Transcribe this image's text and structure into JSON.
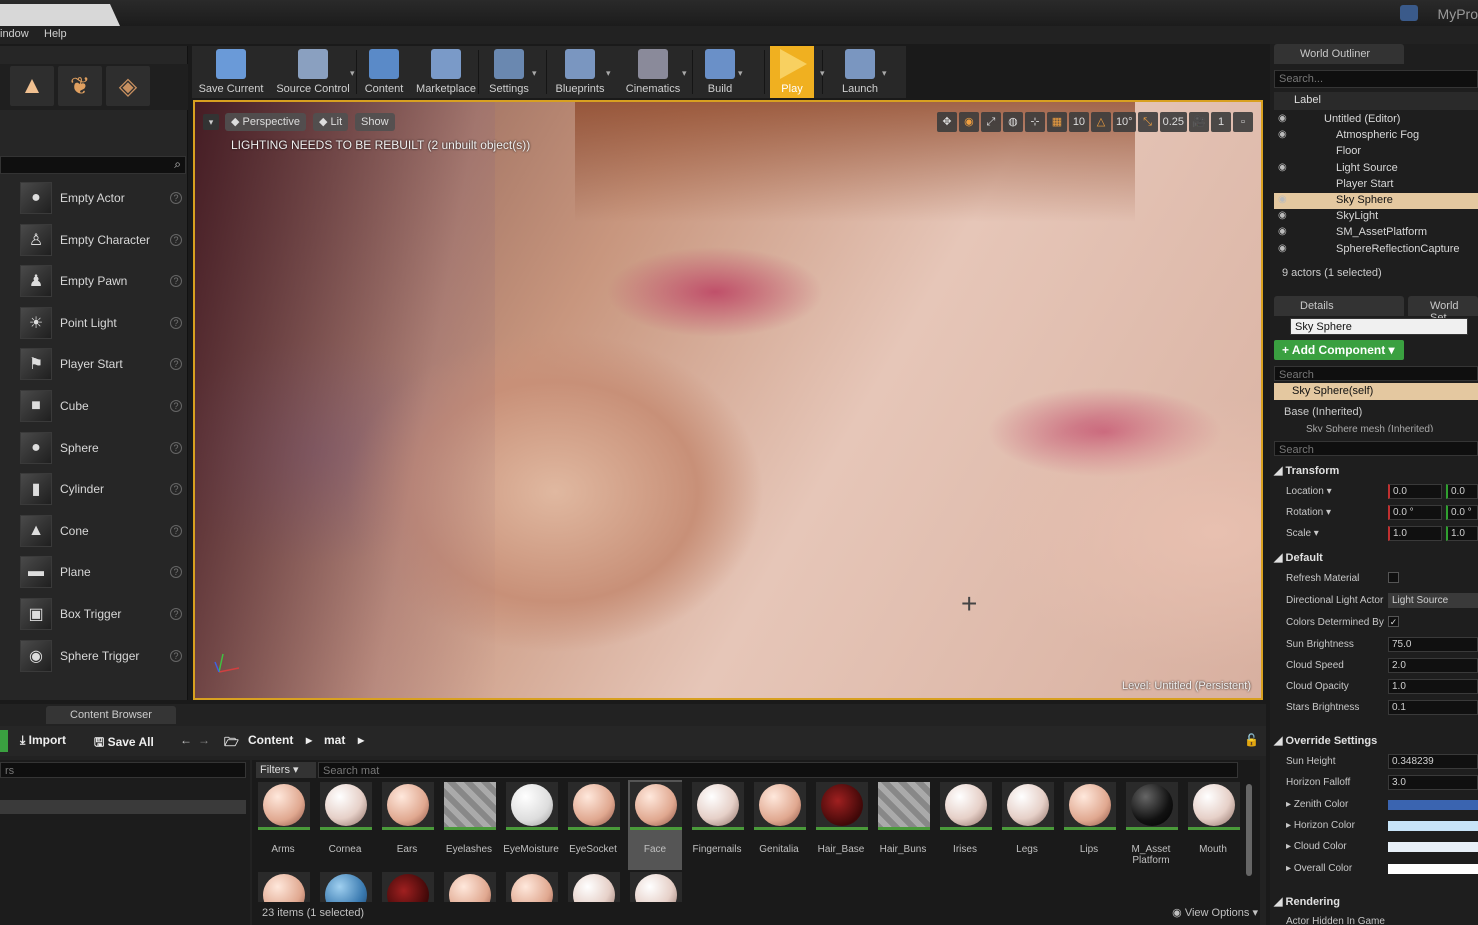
{
  "window": {
    "project_title": "MyPro"
  },
  "menu": [
    "indow",
    "Help"
  ],
  "modes": {
    "tabs": [
      {
        "icon": "place-mode-icon",
        "glyph": "▲"
      },
      {
        "icon": "foliage-mode-icon",
        "glyph": "❦"
      },
      {
        "icon": "geometry-mode-icon",
        "glyph": "◈"
      }
    ],
    "items": [
      {
        "label": "Empty Actor",
        "icon": "sphere-icon",
        "glyph": "●"
      },
      {
        "label": "Empty Character",
        "icon": "character-icon",
        "glyph": "♙"
      },
      {
        "label": "Empty Pawn",
        "icon": "pawn-icon",
        "glyph": "♟"
      },
      {
        "label": "Point Light",
        "icon": "light-bulb-icon",
        "glyph": "☀"
      },
      {
        "label": "Player Start",
        "icon": "player-start-icon",
        "glyph": "⚑"
      },
      {
        "label": "Cube",
        "icon": "cube-icon",
        "glyph": "■"
      },
      {
        "label": "Sphere",
        "icon": "sphere-icon",
        "glyph": "●"
      },
      {
        "label": "Cylinder",
        "icon": "cylinder-icon",
        "glyph": "▮"
      },
      {
        "label": "Cone",
        "icon": "cone-icon",
        "glyph": "▲"
      },
      {
        "label": "Plane",
        "icon": "plane-icon",
        "glyph": "▬"
      },
      {
        "label": "Box Trigger",
        "icon": "box-trigger-icon",
        "glyph": "▣"
      },
      {
        "label": "Sphere Trigger",
        "icon": "sphere-trigger-icon",
        "glyph": "◉"
      }
    ],
    "help_glyph": "?"
  },
  "toolbar": {
    "buttons": [
      {
        "label": "Save Current",
        "icon": "save-icon",
        "color": "#6a9ad8"
      },
      {
        "label": "Source Control",
        "icon": "source-control-icon",
        "color": "#8aa0c0"
      },
      {
        "label": "Content",
        "icon": "content-icon",
        "color": "#5a8ac8"
      },
      {
        "label": "Marketplace",
        "icon": "marketplace-icon",
        "color": "#7a9ac8"
      },
      {
        "label": "Settings",
        "icon": "settings-icon",
        "color": "#6a88b0"
      },
      {
        "label": "Blueprints",
        "icon": "blueprints-icon",
        "color": "#7a96c0"
      },
      {
        "label": "Cinematics",
        "icon": "cinematics-icon",
        "color": "#8a8a9a"
      },
      {
        "label": "Build",
        "icon": "build-icon",
        "color": "#6a90c8"
      },
      {
        "label": "Play",
        "icon": "play-icon",
        "color": "#f0b020"
      },
      {
        "label": "Launch",
        "icon": "launch-icon",
        "color": "#7a96c0"
      }
    ]
  },
  "viewport": {
    "perspective": "Perspective",
    "lit": "Lit",
    "show": "Show",
    "warning": "LIGHTING NEEDS TO BE REBUILT (2 unbuilt object(s))",
    "grid_snap": "10",
    "rot_snap": "10°",
    "scale_snap": "0.25",
    "camera_speed": "1",
    "level": "Level:  Untitled (Persistent)"
  },
  "outliner": {
    "tab": "World Outliner",
    "search_placeholder": "Search...",
    "column": "Label",
    "rows": [
      {
        "name": "Untitled (Editor)",
        "eye": true,
        "indent": 0
      },
      {
        "name": "Atmospheric Fog",
        "eye": true,
        "indent": 1
      },
      {
        "name": "Floor",
        "eye": false,
        "indent": 1
      },
      {
        "name": "Light Source",
        "eye": true,
        "indent": 1
      },
      {
        "name": "Player Start",
        "eye": false,
        "indent": 1
      },
      {
        "name": "Sky Sphere",
        "eye": true,
        "indent": 1,
        "selected": true
      },
      {
        "name": "SkyLight",
        "eye": true,
        "indent": 1
      },
      {
        "name": "SM_AssetPlatform",
        "eye": true,
        "indent": 1
      },
      {
        "name": "SphereReflectionCapture",
        "eye": true,
        "indent": 1
      }
    ],
    "status": "9 actors (1 selected)"
  },
  "details": {
    "tab": "Details",
    "tab2": "World Set",
    "object_name": "Sky Sphere",
    "add_component": "+ Add Component ▾",
    "search_placeholder": "Search",
    "self_row": "Sky Sphere(self)",
    "base_row": "Base (Inherited)",
    "mesh_row": "Sky Sphere mesh (Inherited)",
    "search2_placeholder": "Search",
    "transform": {
      "title": "Transform",
      "location_label": "Location ▾",
      "location": [
        "0.0",
        "0.0"
      ],
      "rotation_label": "Rotation ▾",
      "rotation": [
        "0.0 °",
        "0.0 °"
      ],
      "scale_label": "Scale ▾",
      "scale": [
        "1.0",
        "1.0"
      ]
    },
    "default": {
      "title": "Default",
      "refresh_material": "Refresh Material",
      "directional_light": "Directional Light Actor",
      "directional_light_value": "Light Source",
      "colors_determined": "Colors Determined By",
      "sun_brightness": "Sun Brightness",
      "sun_brightness_value": "75.0",
      "cloud_speed": "Cloud Speed",
      "cloud_speed_value": "2.0",
      "cloud_opacity": "Cloud Opacity",
      "cloud_opacity_value": "1.0",
      "stars_brightness": "Stars Brightness",
      "stars_brightness_value": "0.1"
    },
    "override": {
      "title": "Override Settings",
      "sun_height": "Sun Height",
      "sun_height_value": "0.348239",
      "horizon_falloff": "Horizon Falloff",
      "horizon_falloff_value": "3.0",
      "zenith_color": "Zenith Color",
      "zenith_color_hex": "#3a64b0",
      "horizon_color": "Horizon Color",
      "horizon_color_hex": "#c8e4f8",
      "cloud_color": "Cloud Color",
      "cloud_color_hex": "#e8f0f8",
      "overall_color": "Overall Color",
      "overall_color_hex": "#ffffff"
    },
    "rendering": {
      "title": "Rendering",
      "actor_hidden": "Actor Hidden In Game"
    }
  },
  "content_browser": {
    "tab": "Content Browser",
    "import": "Import",
    "save_all": "Save All",
    "path": [
      "Content",
      "mat"
    ],
    "filters": "Filters ▾",
    "search_placeholder": "Search mat",
    "left_search_placeholder": "rs",
    "assets": [
      {
        "name": "Arms",
        "type": "skin"
      },
      {
        "name": "Cornea",
        "type": "eye"
      },
      {
        "name": "Ears",
        "type": "skin"
      },
      {
        "name": "Eyelashes",
        "type": "lash"
      },
      {
        "name": "EyeMoisture",
        "type": "white"
      },
      {
        "name": "EyeSocket",
        "type": "skin"
      },
      {
        "name": "Face",
        "type": "skin",
        "selected": true
      },
      {
        "name": "Fingernails",
        "type": "eye"
      },
      {
        "name": "Genitalia",
        "type": "skin"
      },
      {
        "name": "Hair_Base",
        "type": "hair"
      },
      {
        "name": "Hair_Buns",
        "type": "lash"
      },
      {
        "name": "Irises",
        "type": "eye"
      },
      {
        "name": "Legs",
        "type": "eye"
      },
      {
        "name": "Lips",
        "type": "skin"
      },
      {
        "name": "M_Asset Platform",
        "type": "black"
      },
      {
        "name": "Mouth",
        "type": "eye"
      }
    ],
    "status": "23 items (1 selected)",
    "view_options": "View Options ▾"
  }
}
